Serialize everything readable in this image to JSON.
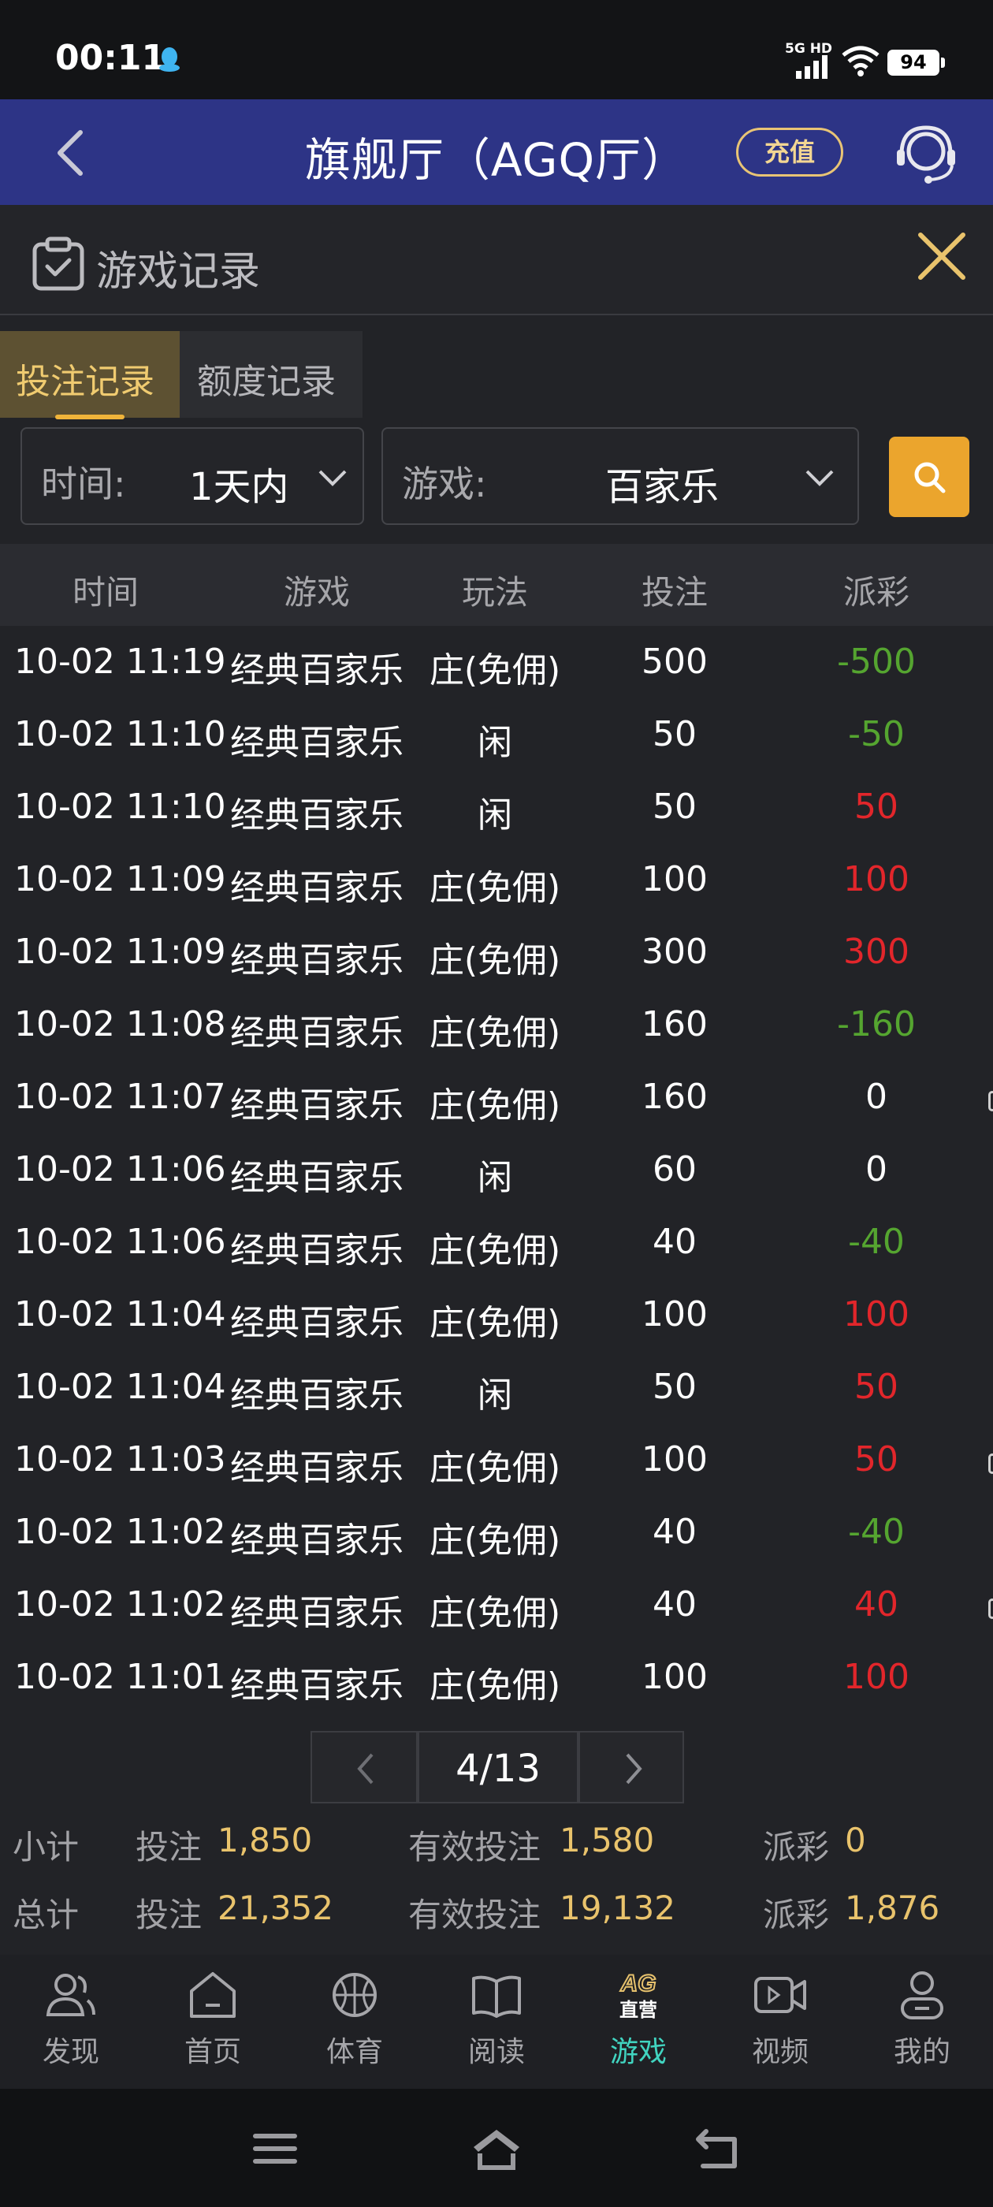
{
  "status_bar": {
    "time": "00:11",
    "network": "5G HD",
    "battery": "94"
  },
  "header": {
    "title": "旗舰厅（AGQ厅）",
    "recharge_label": "充值"
  },
  "records": {
    "title": "游戏记录"
  },
  "tabs": [
    {
      "label": "投注记录",
      "active": true
    },
    {
      "label": "额度记录",
      "active": false
    }
  ],
  "filters": {
    "time_label": "时间:",
    "time_value": "1天内",
    "game_label": "游戏:",
    "game_value": "百家乐"
  },
  "table": {
    "headers": [
      "时间",
      "游戏",
      "玩法",
      "投注",
      "派彩"
    ],
    "rows": [
      {
        "time": "10-02 11:19",
        "game": "经典百家乐",
        "play": "庄(免佣)",
        "bet": "500",
        "payout": "-500"
      },
      {
        "time": "10-02 11:10",
        "game": "经典百家乐",
        "play": "闲",
        "bet": "50",
        "payout": "-50"
      },
      {
        "time": "10-02 11:10",
        "game": "经典百家乐",
        "play": "闲",
        "bet": "50",
        "payout": "50"
      },
      {
        "time": "10-02 11:09",
        "game": "经典百家乐",
        "play": "庄(免佣)",
        "bet": "100",
        "payout": "100"
      },
      {
        "time": "10-02 11:09",
        "game": "经典百家乐",
        "play": "庄(免佣)",
        "bet": "300",
        "payout": "300"
      },
      {
        "time": "10-02 11:08",
        "game": "经典百家乐",
        "play": "庄(免佣)",
        "bet": "160",
        "payout": "-160"
      },
      {
        "time": "10-02 11:07",
        "game": "经典百家乐",
        "play": "庄(免佣)",
        "bet": "160",
        "payout": "0"
      },
      {
        "time": "10-02 11:06",
        "game": "经典百家乐",
        "play": "闲",
        "bet": "60",
        "payout": "0"
      },
      {
        "time": "10-02 11:06",
        "game": "经典百家乐",
        "play": "庄(免佣)",
        "bet": "40",
        "payout": "-40"
      },
      {
        "time": "10-02 11:04",
        "game": "经典百家乐",
        "play": "庄(免佣)",
        "bet": "100",
        "payout": "100"
      },
      {
        "time": "10-02 11:04",
        "game": "经典百家乐",
        "play": "闲",
        "bet": "50",
        "payout": "50"
      },
      {
        "time": "10-02 11:03",
        "game": "经典百家乐",
        "play": "庄(免佣)",
        "bet": "100",
        "payout": "50"
      },
      {
        "time": "10-02 11:02",
        "game": "经典百家乐",
        "play": "庄(免佣)",
        "bet": "40",
        "payout": "-40"
      },
      {
        "time": "10-02 11:02",
        "game": "经典百家乐",
        "play": "庄(免佣)",
        "bet": "40",
        "payout": "40"
      },
      {
        "time": "10-02 11:01",
        "game": "经典百家乐",
        "play": "庄(免佣)",
        "bet": "100",
        "payout": "100"
      }
    ]
  },
  "pagination": {
    "page": "4/13"
  },
  "summary": {
    "subtotal": {
      "label": "小计",
      "bet_label": "投注",
      "bet": "1,850",
      "valid_label": "有效投注",
      "valid": "1,580",
      "payout_label": "派彩",
      "payout": "0"
    },
    "total": {
      "label": "总计",
      "bet_label": "投注",
      "bet": "21,352",
      "valid_label": "有效投注",
      "valid": "19,132",
      "payout_label": "派彩",
      "payout": "1,876"
    }
  },
  "bottom_nav": [
    {
      "label": "发现",
      "icon": "people-icon"
    },
    {
      "label": "首页",
      "icon": "home-icon"
    },
    {
      "label": "体育",
      "icon": "basketball-icon"
    },
    {
      "label": "阅读",
      "icon": "book-icon"
    },
    {
      "label": "游戏",
      "icon": "ag-game-icon",
      "active": true,
      "badge_top": "AG",
      "badge_bottom": "直营"
    },
    {
      "label": "视频",
      "icon": "video-icon"
    },
    {
      "label": "我的",
      "icon": "profile-icon"
    }
  ],
  "colors": {
    "header_bg": "#2d3486",
    "gold": "#e9c36c",
    "win": "#e2262b",
    "loss": "#55a530",
    "active_nav": "#41d4c0"
  }
}
